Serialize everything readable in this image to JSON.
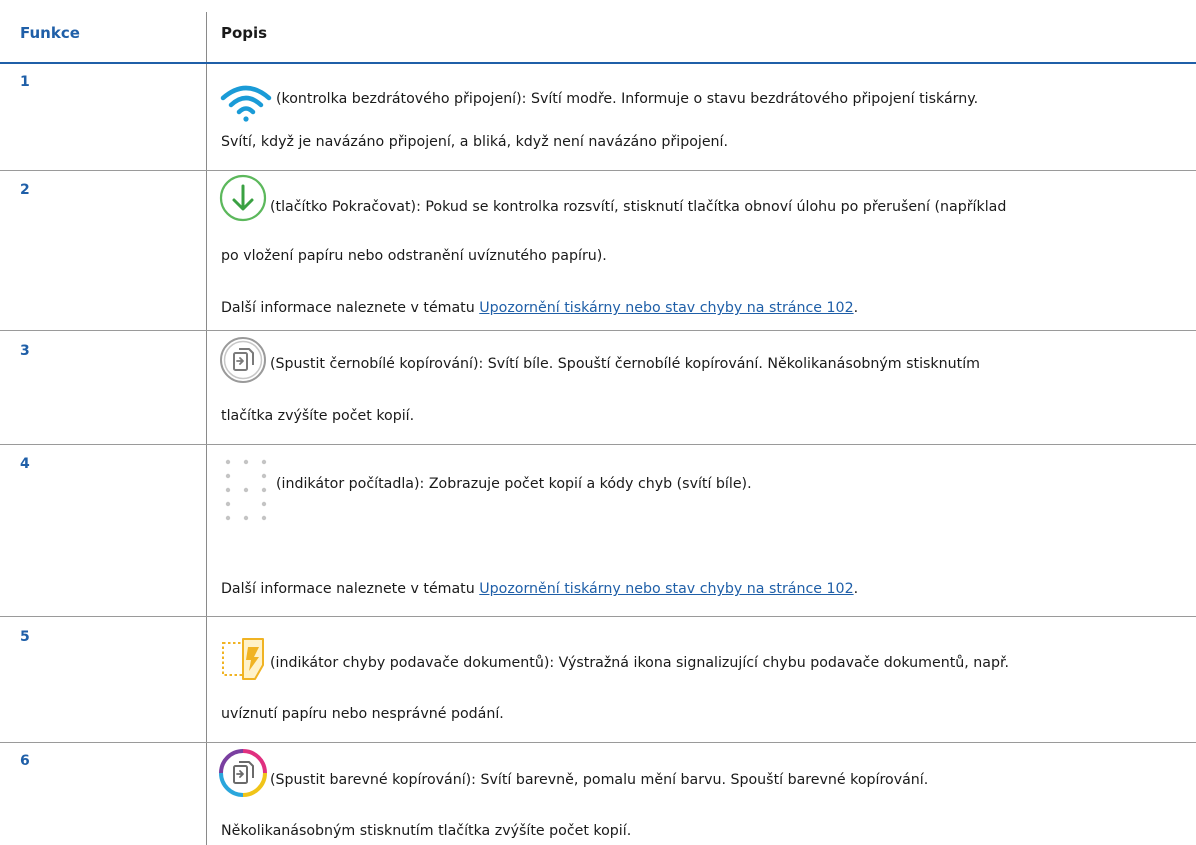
{
  "table": {
    "headers": {
      "feature": "Funkce",
      "description": "Popis"
    },
    "rows": [
      {
        "num": "1",
        "icon": "wireless-icon",
        "line1": "(kontrolka bezdrátového připojení): Svítí modře. Informuje o stavu bezdrátového připojení tiskárny.",
        "line2": "Svítí, když je navázáno připojení, a bliká, když není navázáno připojení."
      },
      {
        "num": "2",
        "icon": "resume-icon",
        "line1": "(tlačítko Pokračovat): Pokud se kontrolka rozsvítí, stisknutí tlačítka obnoví úlohu po přerušení (například",
        "line2": "po vložení papíru nebo odstranění uvíznutého papíru).",
        "more_prefix": "Další informace naleznete v tématu ",
        "more_link": "Upozornění tiskárny nebo stav chyby na stránce 102",
        "more_suffix": "."
      },
      {
        "num": "3",
        "icon": "bw-copy-icon",
        "line1": "(Spustit černobílé kopírování): Svítí bíle. Spouští černobílé kopírování. Několikanásobným stisknutím",
        "line2": "tlačítka zvýšíte počet kopií."
      },
      {
        "num": "4",
        "icon": "counter-indicator-icon",
        "line1": "(indikátor počítadla): Zobrazuje počet kopií a kódy chyb (svítí bíle).",
        "more_prefix": "Další informace naleznete v tématu ",
        "more_link": "Upozornění tiskárny nebo stav chyby na stránce 102",
        "more_suffix": "."
      },
      {
        "num": "5",
        "icon": "document-feeder-error-icon",
        "line1": "(indikátor chyby podavače dokumentů): Výstražná ikona signalizující chybu podavače dokumentů, např.",
        "line2": "uvíznutí papíru nebo nesprávné podání."
      },
      {
        "num": "6",
        "icon": "color-copy-icon",
        "line1": "(Spustit barevné kopírování): Svítí barevně, pomalu mění barvu. Spouští barevné kopírování.",
        "line2": "Několikanásobným stisknutím tlačítka zvýšíte počet kopií."
      }
    ]
  },
  "colors": {
    "accent": "#1f5fa8",
    "wireless": "#1a9bd7",
    "resume": "#3aa142",
    "warning": "#f0b323"
  }
}
